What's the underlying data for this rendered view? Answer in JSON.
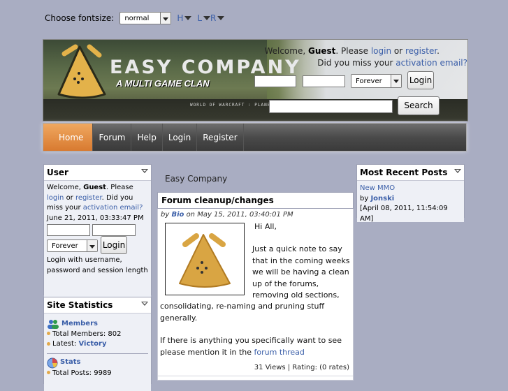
{
  "fontsize": {
    "label": "Choose fontsize:",
    "selected": "normal",
    "options": [
      "H",
      "L",
      "R"
    ]
  },
  "header": {
    "brand": "EASY COMPANY",
    "tagline": "A MULTI GAME CLAN",
    "strip_text": "WORLD OF WARCRAFT : PLANE",
    "welcome_prefix": "Welcome,",
    "guest": "Guest",
    "welcome_mid": ". Please",
    "login_link": "login",
    "or": "or",
    "register_link": "register",
    "period": ".",
    "missed_prefix": "Did you miss your",
    "activation_link": "activation email?",
    "session_select": "Forever",
    "login_button": "Login",
    "search_button": "Search"
  },
  "nav": {
    "items": [
      "Home",
      "Forum",
      "Help",
      "Login",
      "Register"
    ]
  },
  "user_panel": {
    "title": "User",
    "welcome_prefix": "Welcome,",
    "guest": "Guest",
    "welcome_mid": ". Please",
    "login_link": "login",
    "or": "or",
    "register_link": "register",
    "period": ".",
    "missed_prefix": "Did you miss your",
    "activation_link": "activation email?",
    "datetime": "June 21, 2011, 03:33:47 PM",
    "session_select": "Forever",
    "login_button": "Login",
    "hint": "Login with username, password and session length"
  },
  "stats_panel": {
    "title": "Site Statistics",
    "members_label": "Members",
    "total_members": "Total Members: 802",
    "latest_prefix": "Latest:",
    "latest_name": "Victory",
    "stats_label": "Stats",
    "total_posts": "Total Posts: 9989"
  },
  "main": {
    "site_title": "Easy Company",
    "article_title": "Forum cleanup/changes",
    "by": "by",
    "author": "Bio",
    "date": "on May 15, 2011, 03:40:01 PM",
    "greeting": "Hi All,",
    "p1": "Just a quick note to say that in the coming weeks we will be having a clean up of the forums, removing old sections, consolidating, re-naming and pruning stuff generally.",
    "p2_prefix": "If there is anything you specifically want to see please mention it in the",
    "p2_link": "forum thread",
    "views": "31 Views",
    "rating": "Rating: (0 rates)"
  },
  "recent_panel": {
    "title": "Most Recent Posts",
    "post_title": "New MMO",
    "by": "by",
    "author": "Jonski",
    "date": "[April 08, 2011, 11:54:09 AM]"
  },
  "colors": {
    "background": "#a9adc2",
    "link": "#3a5ea8",
    "nav_active": "#e08a3c",
    "logo_gold": "#e3b24a"
  }
}
